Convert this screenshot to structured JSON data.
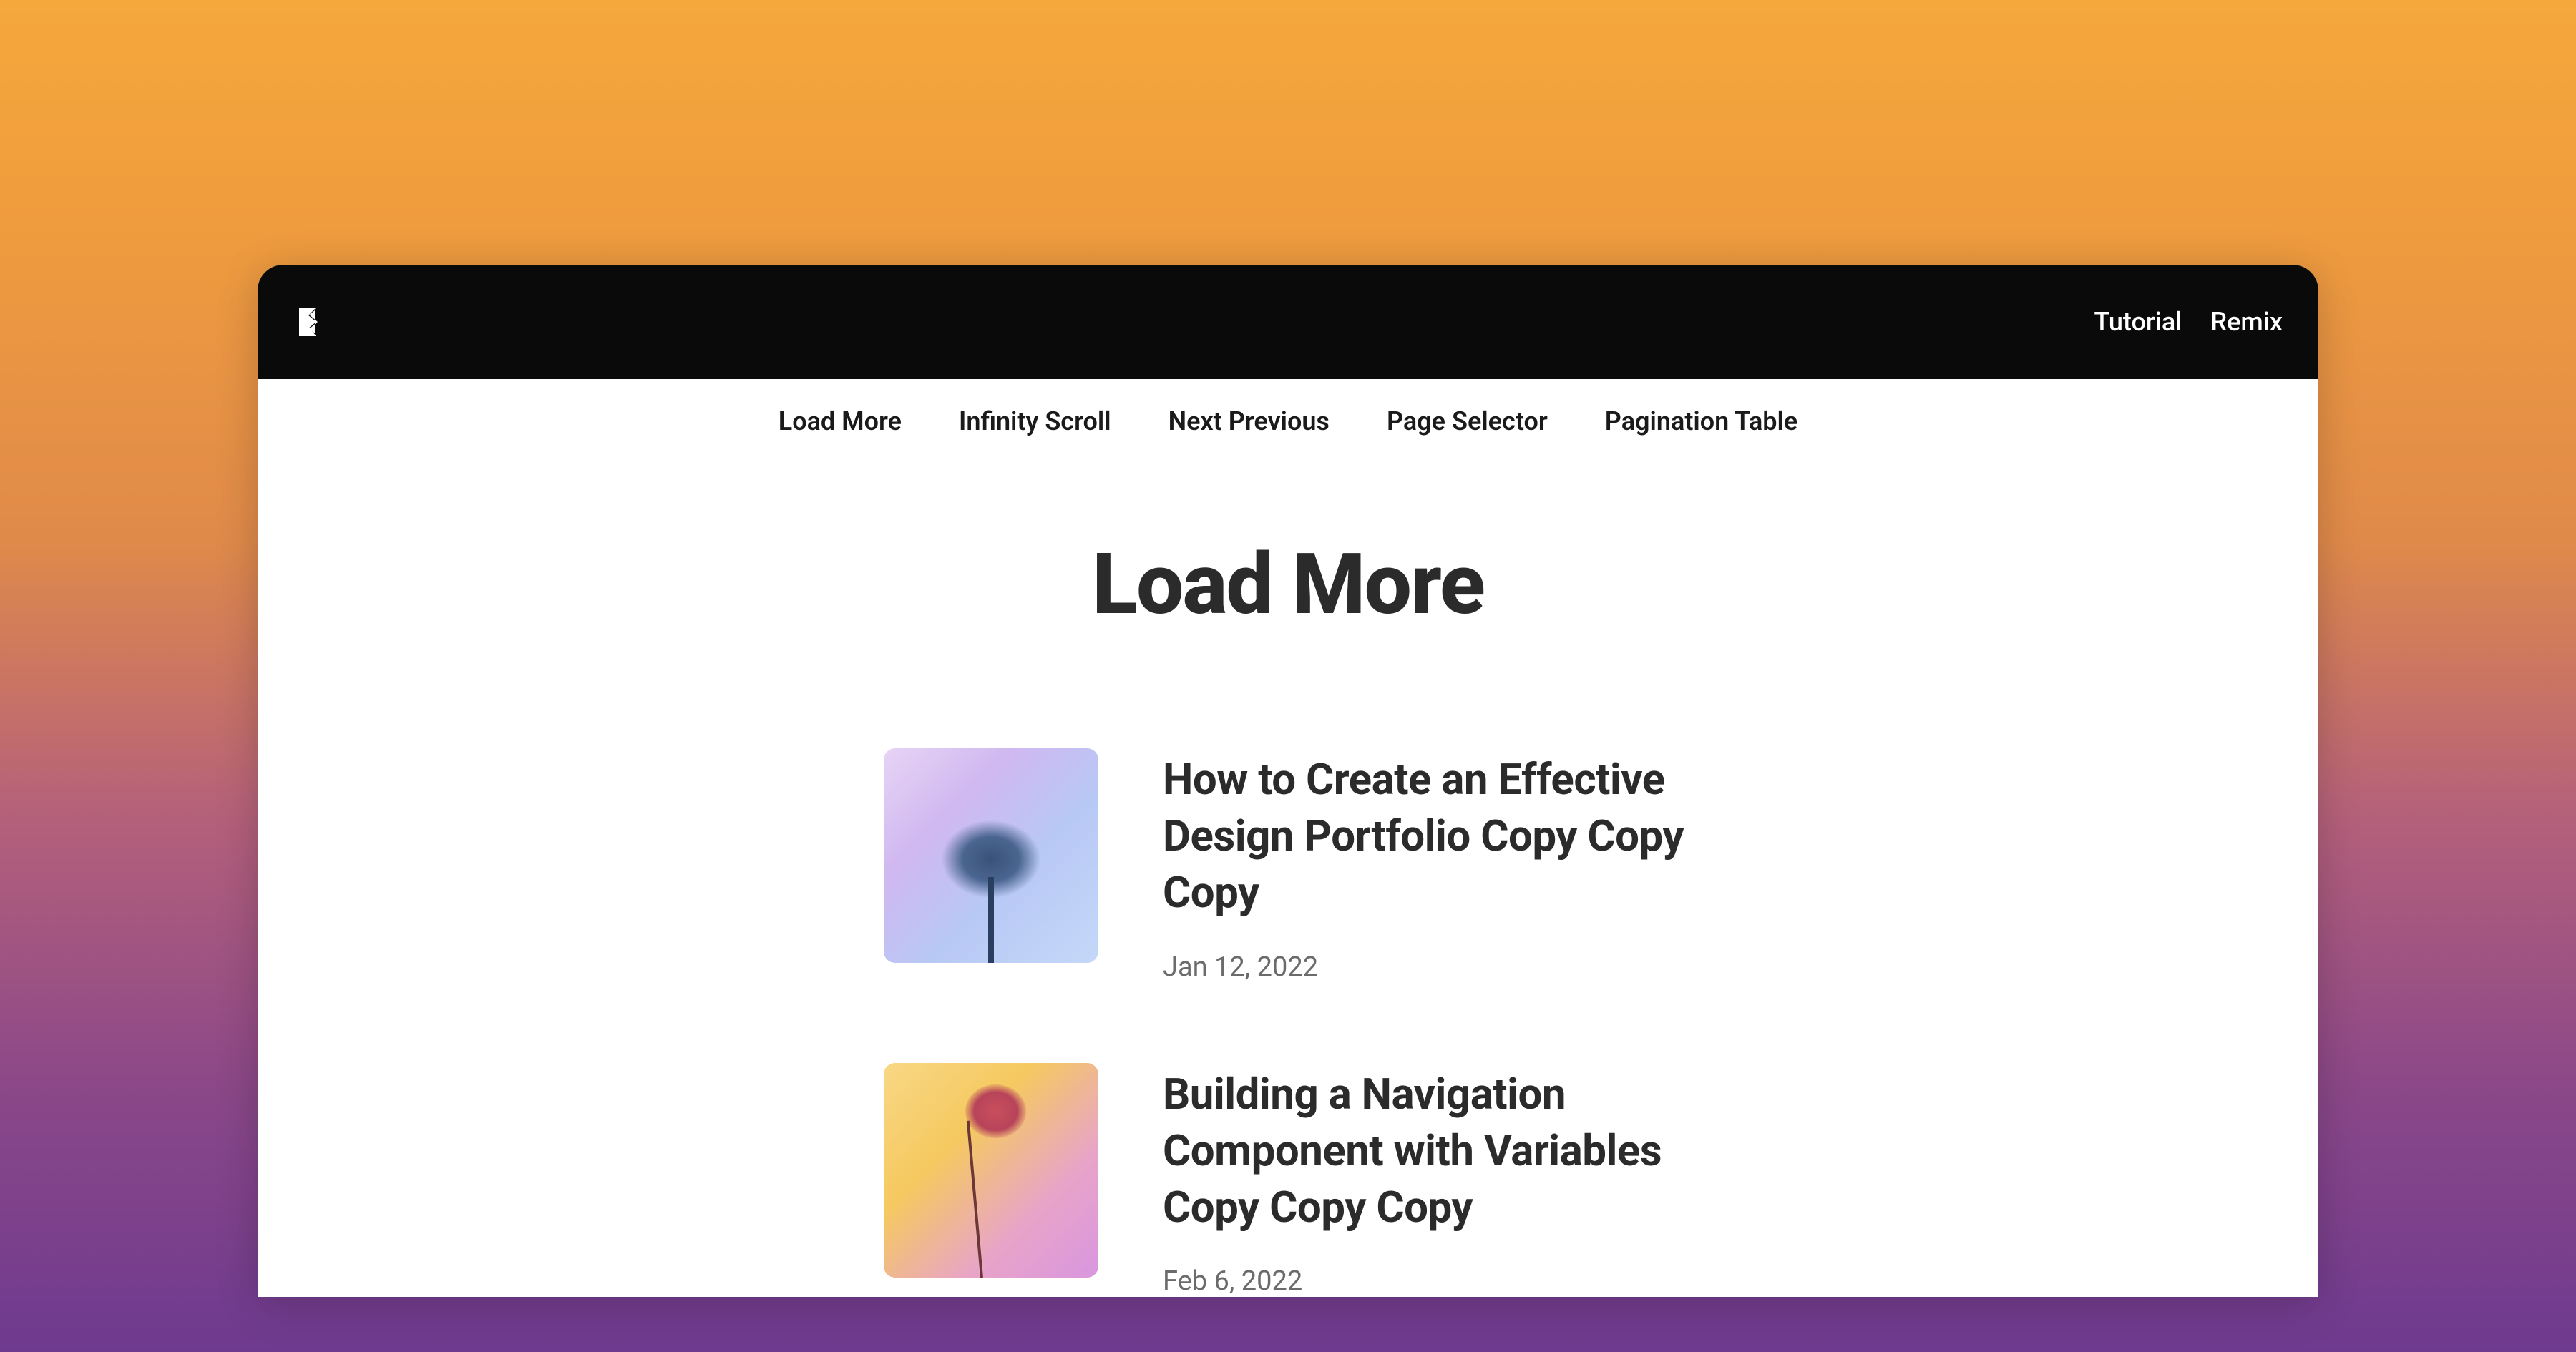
{
  "header": {
    "nav": [
      {
        "label": "Tutorial"
      },
      {
        "label": "Remix"
      }
    ]
  },
  "tabs": [
    {
      "label": "Load More"
    },
    {
      "label": "Infinity Scroll"
    },
    {
      "label": "Next Previous"
    },
    {
      "label": "Page Selector"
    },
    {
      "label": "Pagination Table"
    }
  ],
  "page": {
    "title": "Load More"
  },
  "posts": [
    {
      "title": "How to Create an Effective Design Portfolio Copy Copy Copy",
      "date": "Jan 12, 2022"
    },
    {
      "title": "Building a Navigation Component with Variables Copy Copy Copy",
      "date": "Feb 6, 2022"
    }
  ]
}
